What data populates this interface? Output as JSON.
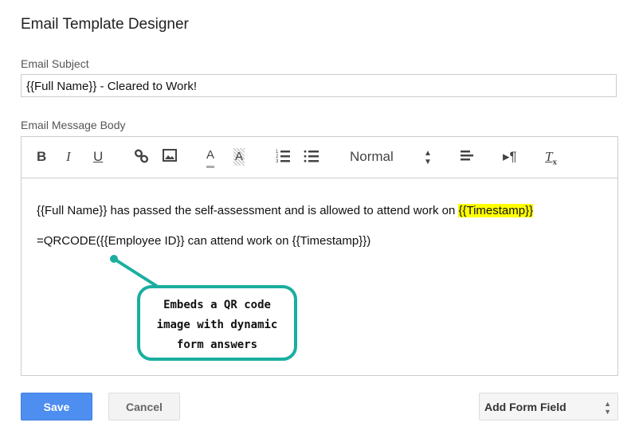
{
  "title": "Email Template Designer",
  "subject": {
    "label": "Email Subject",
    "value": "{{Full Name}} - Cleared to Work!"
  },
  "body": {
    "label": "Email Message Body",
    "toolbar": {
      "bold": "B",
      "italic": "I",
      "underline": "U",
      "format_select": "Normal",
      "icons": [
        "bold-icon",
        "italic-icon",
        "underline-icon",
        "link-icon",
        "image-icon",
        "text-color-icon",
        "background-color-icon",
        "ordered-list-icon",
        "bullet-list-icon",
        "align-icon",
        "text-direction-icon",
        "clear-format-icon"
      ]
    },
    "line1_text": "{{Full Name}} has passed the self-assessment and is allowed to attend work on ",
    "line1_highlight": "{{Timestamp}}",
    "highlight_color": "#ffff00",
    "line2": "=QRCODE({{Employee ID}} can attend work on {{Timestamp}})"
  },
  "callout": {
    "lines": [
      "Embeds a QR code",
      "image with dynamic",
      "form answers"
    ],
    "color": "#1aae9f"
  },
  "buttons": {
    "save": "Save",
    "cancel": "Cancel",
    "add_form_field": "Add Form Field"
  },
  "colors": {
    "save": "#4d8ef0"
  }
}
